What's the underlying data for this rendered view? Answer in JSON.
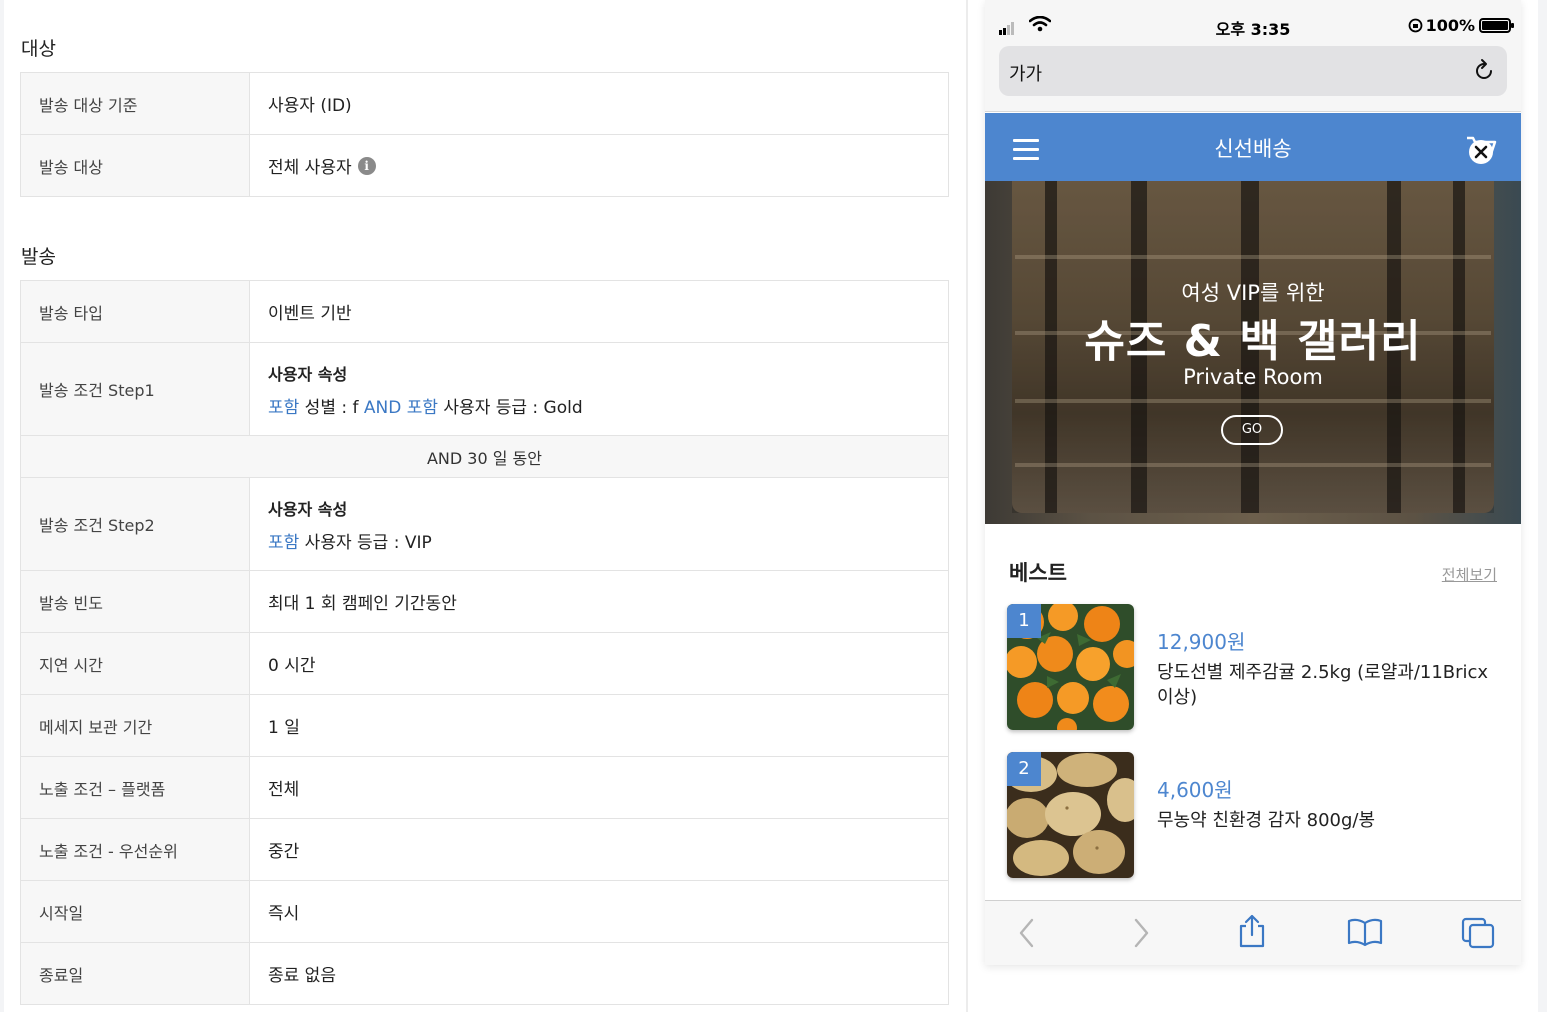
{
  "target_section": {
    "title": "대상",
    "rows": [
      {
        "label": "발송 대상 기준",
        "value": "사용자 (ID)"
      },
      {
        "label": "발송 대상",
        "value": "전체 사용자"
      }
    ]
  },
  "send_section": {
    "title": "발송",
    "type": {
      "label": "발송 타입",
      "value": "이벤트 기반"
    },
    "step1": {
      "label": "발송 조건 Step1",
      "heading": "사용자 속성",
      "inc1": "포함",
      "text1": " 성별 : f ",
      "and": "AND",
      "inc2": " 포함",
      "text2": " 사용자 등급 : Gold"
    },
    "between": "AND 30 일 동안",
    "step2": {
      "label": "발송 조건 Step2",
      "heading": "사용자 속성",
      "inc1": "포함",
      "text1": " 사용자 등급 : VIP"
    },
    "rows": [
      {
        "label": "발송 빈도",
        "value": "최대 1 회 캠페인 기간동안"
      },
      {
        "label": "지연 시간",
        "value": "0 시간"
      },
      {
        "label": "메세지 보관 기간",
        "value": "1 일"
      },
      {
        "label": "노출 조건 – 플랫폼",
        "value": "전체"
      },
      {
        "label": "노출 조건 - 우선순위",
        "value": "중간"
      },
      {
        "label": "시작일",
        "value": "즉시"
      },
      {
        "label": "종료일",
        "value": "종료 없음"
      }
    ]
  },
  "phone": {
    "status": {
      "time": "오후 3:35",
      "battery": "100%"
    },
    "url_bar": {
      "text_size_button": "가가",
      "reload_icon": "reload-icon"
    },
    "app": {
      "title": "신선배송",
      "menu_icon": "hamburger-icon",
      "cart_icon": "cart-close-icon"
    },
    "hero": {
      "subtitle": "여성 VIP를 위한",
      "title": "슈즈 & 백 갤러리",
      "english": "Private Room",
      "button": "GO"
    },
    "best": {
      "title": "베스트",
      "see_all": "전체보기",
      "products": [
        {
          "rank": "1",
          "price": "12,900원",
          "name": "당도선별 제주감귤 2.5kg (로얄과/11Bricx 이상)"
        },
        {
          "rank": "2",
          "price": "4,600원",
          "name": "무농약 친환경 감자 800g/봉"
        }
      ]
    },
    "toolbar": [
      "back-icon",
      "forward-icon",
      "share-icon",
      "bookmarks-icon",
      "tabs-icon"
    ],
    "colors": {
      "brand": "#4d86cf",
      "link": "#3b78c4"
    }
  }
}
